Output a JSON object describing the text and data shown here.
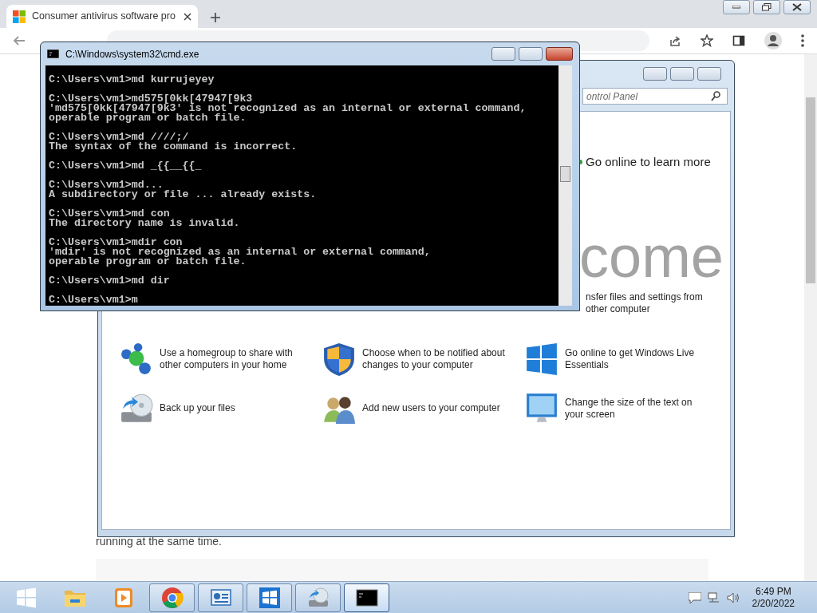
{
  "browser": {
    "tab": {
      "title": "Consumer antivirus software pro"
    },
    "page_text": "running at the same time."
  },
  "control_panel": {
    "search": {
      "placeholder": "ontrol Panel"
    },
    "link": "Go online to learn more",
    "heading": "come",
    "partial_text": [
      "nsfer files and settings from",
      "other computer"
    ],
    "tasks": [
      {
        "kind": "homegroup",
        "label": "Use a homegroup to share with other computers in your home"
      },
      {
        "kind": "shield",
        "label": "Choose when to be notified about changes to your computer"
      },
      {
        "kind": "windows",
        "label": "Go online to get Windows Live Essentials"
      },
      {
        "kind": "backup",
        "label": "Back up your files"
      },
      {
        "kind": "users",
        "label": "Add new users to your computer"
      },
      {
        "kind": "monitor",
        "label": "Change the size of the text on your screen"
      }
    ]
  },
  "cmd": {
    "title": "C:\\Windows\\system32\\cmd.exe",
    "blocks": [
      [
        "C:\\Users\\vm1>md kurrujeyey"
      ],
      [
        "C:\\Users\\vm1>md575[0kk[47947[9k3",
        "'md575[0kk[47947[9k3' is not recognized as an internal or external command,",
        "operable program or batch file."
      ],
      [
        "C:\\Users\\vm1>md ////;/",
        "The syntax of the command is incorrect."
      ],
      [
        "C:\\Users\\vm1>md _{{__{{_"
      ],
      [
        "C:\\Users\\vm1>md...",
        "A subdirectory or file ... already exists."
      ],
      [
        "C:\\Users\\vm1>md con",
        "The directory name is invalid."
      ],
      [
        "C:\\Users\\vm1>mdir con",
        "'mdir' is not recognized as an internal or external command,",
        "operable program or batch file."
      ],
      [
        "C:\\Users\\vm1>md dir"
      ],
      [
        "C:\\Users\\vm1>m"
      ]
    ]
  },
  "taskbar": {
    "items": [
      {
        "kind": "start",
        "running": false,
        "selected": false
      },
      {
        "kind": "explorer",
        "running": false,
        "selected": false
      },
      {
        "kind": "media",
        "running": false,
        "selected": false
      },
      {
        "kind": "chrome",
        "running": true,
        "selected": false
      },
      {
        "kind": "control_panel",
        "running": true,
        "selected": false
      },
      {
        "kind": "store",
        "running": true,
        "selected": false
      },
      {
        "kind": "backup",
        "running": true,
        "selected": false
      },
      {
        "kind": "cmd",
        "running": true,
        "selected": true
      }
    ],
    "clock": {
      "time": "6:49 PM",
      "date": "2/20/2022"
    }
  }
}
